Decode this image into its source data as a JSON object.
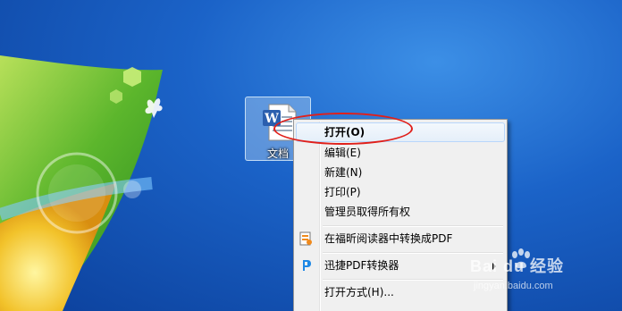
{
  "desktop": {
    "file_icon": {
      "name": "文档",
      "icon": "word-document-icon"
    }
  },
  "context_menu": {
    "items": [
      {
        "label": "打开(O)",
        "bold": true,
        "highlighted": true
      },
      {
        "label": "编辑(E)"
      },
      {
        "label": "新建(N)"
      },
      {
        "label": "打印(P)"
      },
      {
        "label": "管理员取得所有权"
      },
      {
        "label": "在福昕阅读器中转换成PDF",
        "icon": "foxit-reader-icon"
      },
      {
        "label": "迅捷PDF转换器",
        "icon": "pdf-converter-icon",
        "submenu": true
      },
      {
        "label": "打开方式(H)..."
      }
    ]
  },
  "annotation": {
    "color": "#e0201b"
  },
  "watermark": {
    "brand_text": "Bai du 经验",
    "url": "jingyan.baidu.com"
  }
}
